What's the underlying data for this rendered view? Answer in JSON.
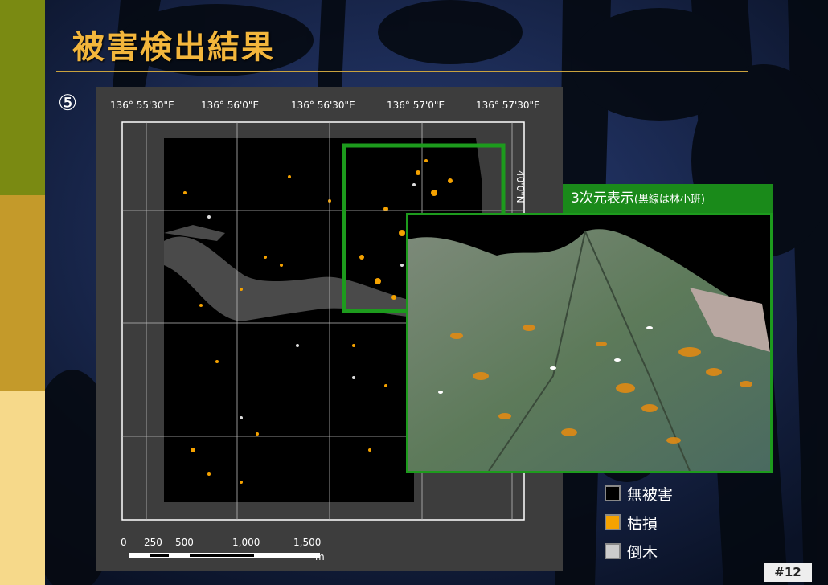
{
  "slide": {
    "title": "被害検出結果",
    "marker": "⑤",
    "page_number": "#12"
  },
  "map": {
    "lon_labels": [
      "136° 55'30\"E",
      "136° 56'0\"E",
      "136° 56'30\"E",
      "136° 57'0\"E",
      "136° 57'30\"E"
    ],
    "lat_label": "40'0\"N",
    "scale_ticks": [
      "0",
      "250",
      "500",
      "1,000",
      "1,500"
    ],
    "scale_unit": "m"
  },
  "view3d": {
    "title": "3次元表示",
    "subtitle": "(黒線は林小班)"
  },
  "legend": [
    {
      "label": "無被害",
      "color": "#000000"
    },
    {
      "label": "枯損",
      "color": "#f5a200"
    },
    {
      "label": "倒木",
      "color": "#cccccc"
    }
  ],
  "colors": {
    "title": "#f3b63c",
    "highlight_box": "#1d9b1d",
    "sidebar": [
      "#7a8a12",
      "#c49a2a",
      "#f6d98a"
    ]
  }
}
